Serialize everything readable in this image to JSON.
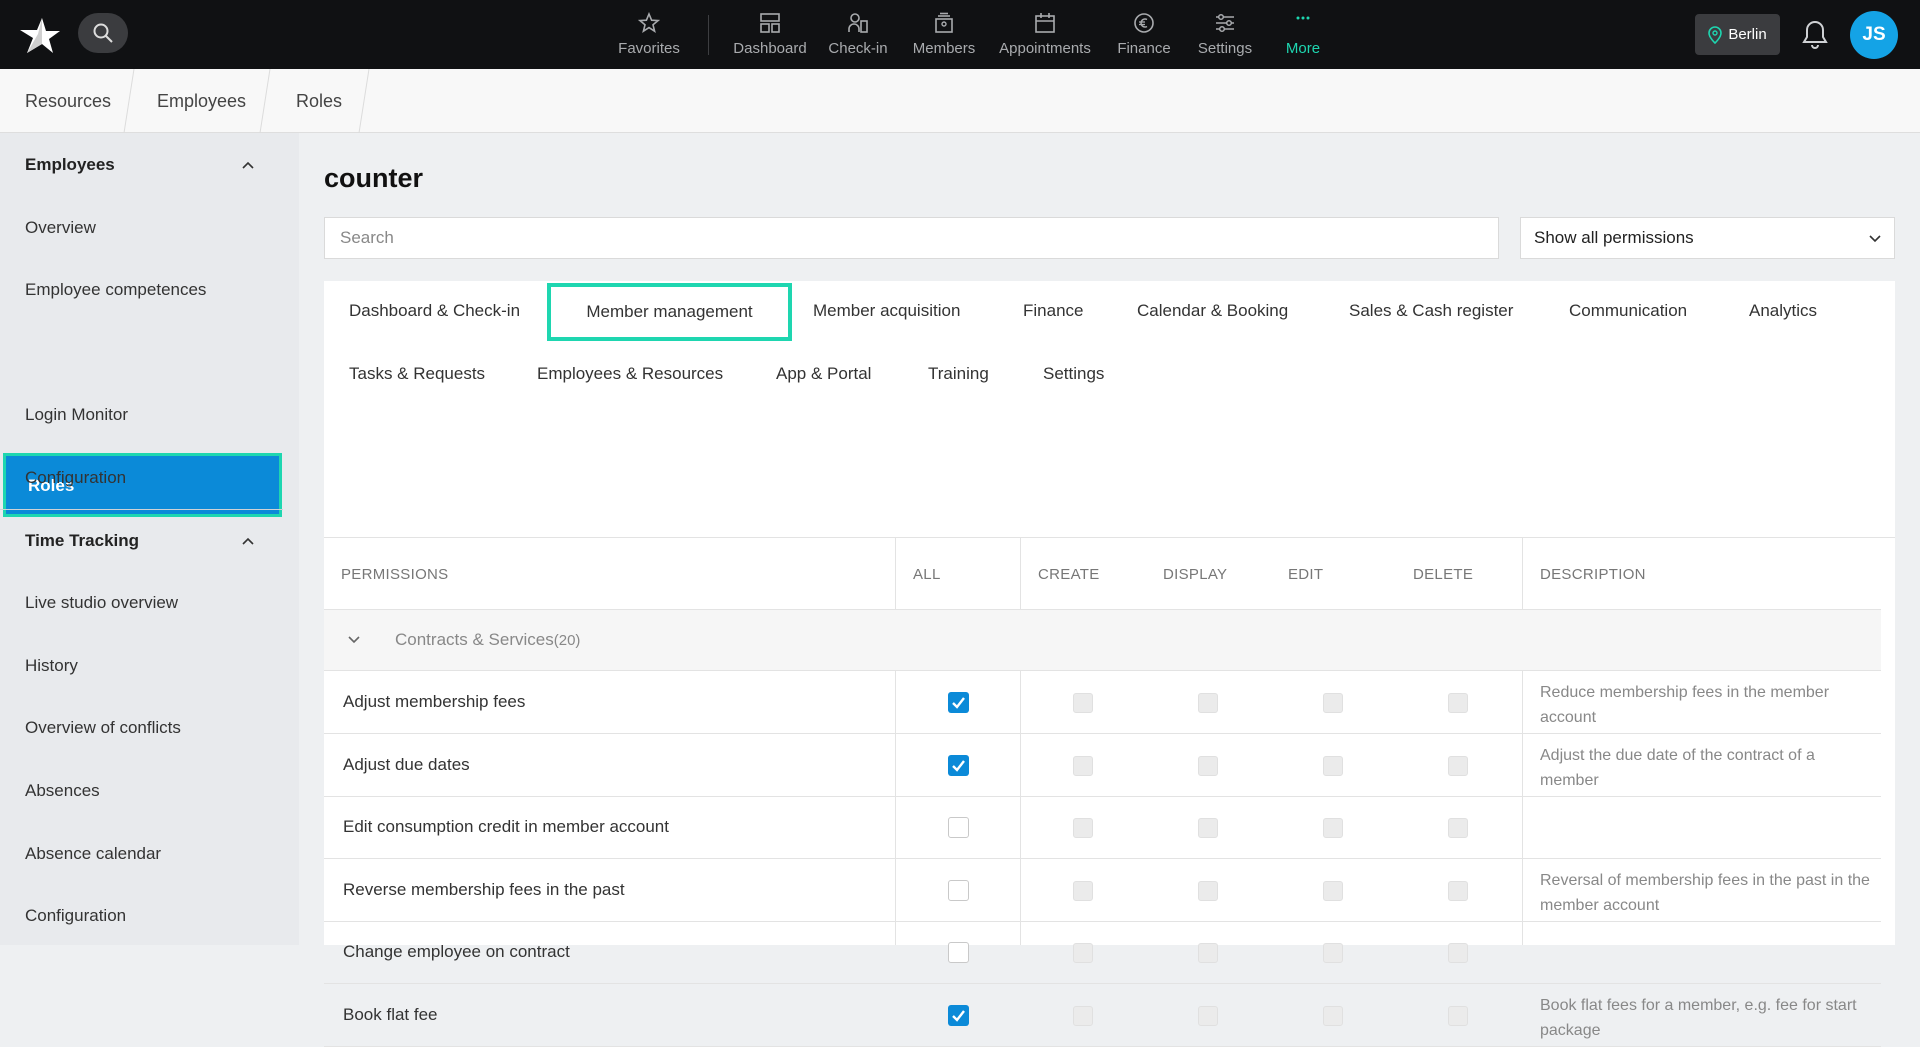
{
  "topbar": {
    "nav": [
      {
        "label": "Favorites",
        "icon": "star-icon"
      },
      {
        "label": "Dashboard",
        "icon": "dashboard-icon"
      },
      {
        "label": "Check-in",
        "icon": "checkin-icon"
      },
      {
        "label": "Members",
        "icon": "members-icon"
      },
      {
        "label": "Appointments",
        "icon": "calendar-icon"
      },
      {
        "label": "Finance",
        "icon": "euro-icon"
      },
      {
        "label": "Settings",
        "icon": "sliders-icon"
      },
      {
        "label": "More",
        "icon": "more-icon"
      }
    ],
    "location": "Berlin",
    "avatar_initials": "JS",
    "accent_color": "#1ed6b0"
  },
  "breadcrumb": [
    "Resources",
    "Employees",
    "Roles"
  ],
  "sidebar": {
    "sections": [
      {
        "title": "Employees",
        "items": [
          "Overview",
          "Employee competences",
          "Roles",
          "Login Monitor",
          "Configuration"
        ]
      },
      {
        "title": "Time Tracking",
        "items": [
          "Live studio overview",
          "History",
          "Overview of conflicts",
          "Absences",
          "Absence calendar",
          "Configuration"
        ]
      }
    ],
    "active_item": "Roles"
  },
  "main": {
    "title": "counter",
    "search_placeholder": "Search",
    "filter_value": "Show all permissions",
    "tabs_row1": [
      "Dashboard & Check-in",
      "Member management",
      "Member acquisition",
      "Finance",
      "Calendar & Booking",
      "Sales & Cash register",
      "Communication",
      "Analytics"
    ],
    "tabs_row2": [
      "Tasks & Requests",
      "Employees & Resources",
      "App & Portal",
      "Training",
      "Settings"
    ],
    "active_tab": "Member management",
    "columns": [
      "PERMISSIONS",
      "ALL",
      "CREATE",
      "DISPLAY",
      "EDIT",
      "DELETE",
      "DESCRIPTION"
    ],
    "group": {
      "label": "Contracts & Services",
      "count": "(20)"
    },
    "rows": [
      {
        "name": "Adjust membership fees",
        "all": true,
        "desc": "Reduce membership fees in the member account"
      },
      {
        "name": "Adjust due dates",
        "all": true,
        "desc": "Adjust the due date of the contract of a member"
      },
      {
        "name": "Edit consumption credit in member account",
        "all": false,
        "desc": ""
      },
      {
        "name": "Reverse membership fees in the past",
        "all": false,
        "desc": "Reversal of membership fees in the past in the member account"
      },
      {
        "name": "Change employee on contract",
        "all": false,
        "desc": ""
      },
      {
        "name": "Book flat fee",
        "all": true,
        "desc": "Book flat fees for a member, e.g. fee for start package"
      }
    ]
  }
}
